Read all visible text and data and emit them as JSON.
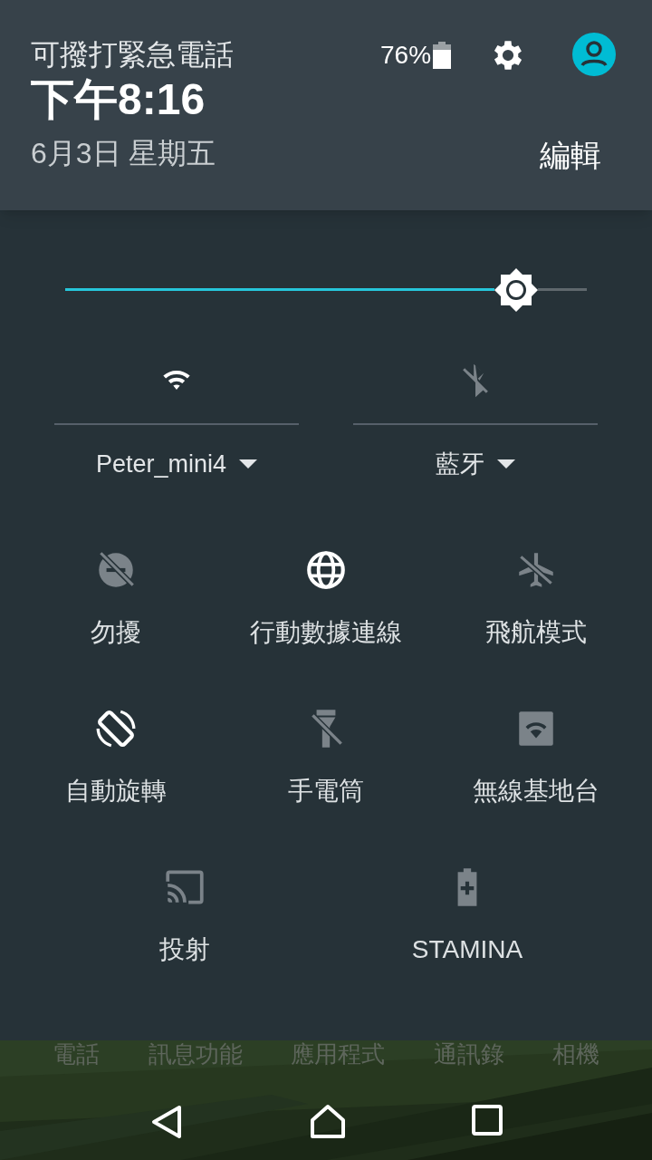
{
  "header": {
    "carrier": "可撥打緊急電話",
    "time": "下午8:16",
    "date": "6月3日 星期五",
    "battery": "76%",
    "edit": "編輯"
  },
  "brightness": {
    "level": 0.865
  },
  "big_tiles": [
    {
      "kind": "wifi",
      "label": "Peter_mini4",
      "on": true
    },
    {
      "kind": "bluetooth",
      "label": "藍牙",
      "on": false
    }
  ],
  "tile_rows": [
    [
      {
        "kind": "dnd",
        "label": "勿擾",
        "on": false
      },
      {
        "kind": "data",
        "label": "行動數據連線",
        "on": true
      },
      {
        "kind": "airplane",
        "label": "飛航模式",
        "on": false
      }
    ],
    [
      {
        "kind": "rotate",
        "label": "自動旋轉",
        "on": true
      },
      {
        "kind": "flashlight",
        "label": "手電筒",
        "on": false
      },
      {
        "kind": "hotspot",
        "label": "無線基地台",
        "on": false
      }
    ],
    [
      {
        "kind": "cast",
        "label": "投射",
        "on": false
      },
      {
        "kind": "stamina",
        "label": "STAMINA",
        "on": false
      }
    ]
  ],
  "dock": [
    "電話",
    "訊息功能",
    "應用程式",
    "通訊錄",
    "相機"
  ]
}
